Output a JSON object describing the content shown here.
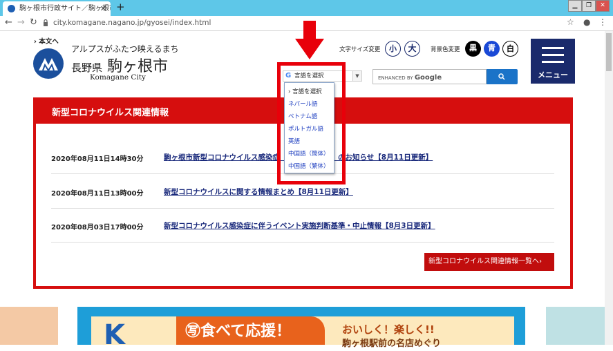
{
  "browser": {
    "tab_title": "駒ヶ根市行政サイト／駒ヶ根市アル",
    "url": "city.komagane.nagano.jp/gyosei/index.html"
  },
  "header": {
    "skip_link": "› 本文へ",
    "tagline": "アルプスがふたつ映えるまち",
    "prefecture": "長野県",
    "city": "駒ヶ根市",
    "city_en": "Komagane City",
    "font_size_label": "文字サイズ変更",
    "font_small": "小",
    "font_large": "大",
    "bg_color_label": "背景色変更",
    "bg_black": "黒",
    "bg_blue": "青",
    "bg_white": "白",
    "menu_label": "メニュー"
  },
  "translate": {
    "selected": "言語を選択",
    "options": [
      "› 言語を選択",
      "ネパール語",
      "ベトナム語",
      "ポルトガル語",
      "英語",
      "中国語（簡体）",
      "中国語（繁体）"
    ]
  },
  "search": {
    "placeholder_small": "ENHANCED BY",
    "placeholder_brand": "Google"
  },
  "covid": {
    "title": "新型コロナウイルス関連情報",
    "items": [
      {
        "date": "2020年08月11日14時30分",
        "title": "駒ヶ根市新型コロナウイルス感染症　　　　　　　　のお知らせ【8月11日更新】"
      },
      {
        "date": "2020年08月11日13時00分",
        "title": "新型コロナウイルスに関する情報まとめ【8月11日更新】"
      },
      {
        "date": "2020年08月03日17時00分",
        "title": "新型コロナウイルス感染症に伴うイベント実施判断基準・中止情報【8月3日更新】"
      }
    ],
    "more": "新型コロナウイルス関連情報一覧へ›"
  },
  "banner": {
    "letter": "K",
    "tag": "㊢食べて応援！",
    "line1": "おいしく！楽しく!!",
    "line2": "駒ヶ根駅前の名店めぐり"
  },
  "colors": {
    "accent_red": "#d60e0e",
    "navy": "#1a2a6c",
    "chrome": "#5ec7e8"
  }
}
